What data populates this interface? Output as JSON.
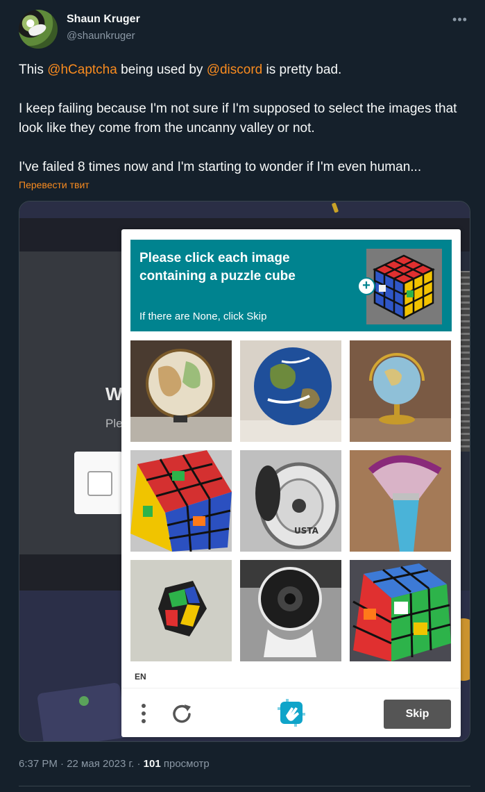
{
  "tweet": {
    "author_name": "Shaun Kruger",
    "author_handle": "@shaunkruger",
    "more_icon": "ellipsis-icon",
    "text": {
      "p1_a": "This ",
      "mention_1": "@hCaptcha",
      "p1_b": " being used by ",
      "mention_2": "@discord",
      "p1_c": " is pretty bad.",
      "p2": "I keep failing because I'm not sure if I'm supposed to select the images that look like they come from the uncanny valley or not.",
      "p3": "I've failed 8 times now and I'm starting to wonder if I'm even human..."
    },
    "translate_label": "Перевести твит",
    "time": "6:37 PM · 22 мая 2023 г. · ",
    "views_count": "101",
    "views_label": " просмотр"
  },
  "background": {
    "heading_fragment": "W",
    "sub_fragment": "Ple"
  },
  "captcha": {
    "prompt_main": "Please click each image containing a puzzle cube",
    "prompt_sub": "If there are None, click Skip",
    "tiles": [
      {
        "label": "globe-image-1"
      },
      {
        "label": "earth-image"
      },
      {
        "label": "globe-image-2"
      },
      {
        "label": "puzzle-cube-image-1"
      },
      {
        "label": "dumbbell-image"
      },
      {
        "label": "makeup-brush-image"
      },
      {
        "label": "puzzle-cube-image-2"
      },
      {
        "label": "webcam-image"
      },
      {
        "label": "puzzle-cube-image-3"
      }
    ],
    "language": "EN",
    "skip_label": "Skip"
  },
  "colors": {
    "accent": "#f98b1f",
    "background": "#15202b",
    "captcha_prompt": "#00838f",
    "skip_button": "#555555"
  }
}
